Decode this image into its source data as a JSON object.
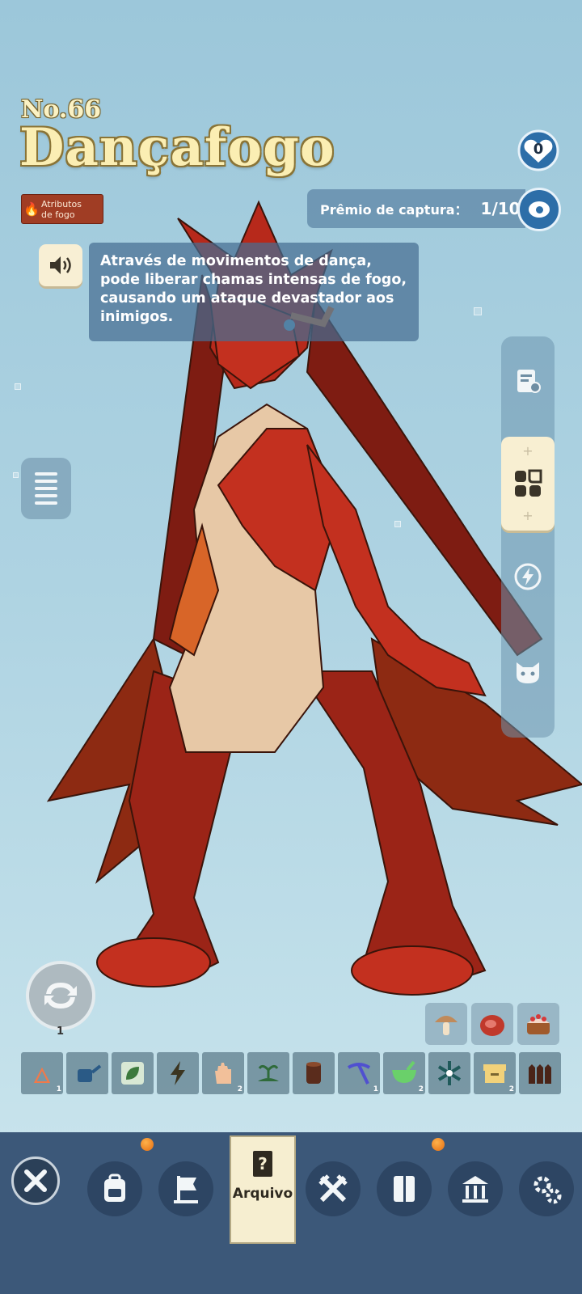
{
  "monster": {
    "number": "No.66",
    "name": "Dançafogo",
    "attribute_line1": "Atributos",
    "attribute_line2": "de fogo",
    "favorite_count": "0",
    "capture_label": "Prêmio de captura：",
    "capture_value": "1/10",
    "description": "Através de movimentos de dança, pode liberar chamas intensas de fogo, causando um ataque devastador aos inimigos."
  },
  "swap": {
    "count": "1",
    "icon": "swap-arrows-icon"
  },
  "food": [
    "mushroom-icon",
    "meat-icon",
    "cake-icon"
  ],
  "skills": [
    {
      "icon": "campfire-icon",
      "count": "1"
    },
    {
      "icon": "watering-can-icon",
      "count": ""
    },
    {
      "icon": "leaf-icon",
      "count": ""
    },
    {
      "icon": "lightning-icon",
      "count": ""
    },
    {
      "icon": "hand-icon",
      "count": "2"
    },
    {
      "icon": "sprout-icon",
      "count": ""
    },
    {
      "icon": "log-icon",
      "count": ""
    },
    {
      "icon": "pickaxe-icon",
      "count": "1"
    },
    {
      "icon": "mortar-icon",
      "count": "2"
    },
    {
      "icon": "snowflake-icon",
      "count": ""
    },
    {
      "icon": "box-icon",
      "count": "2"
    },
    {
      "icon": "fence-icon",
      "count": ""
    }
  ],
  "side_tabs": [
    "stats-icon",
    "grid-icon",
    "lightning-icon",
    "cat-icon"
  ],
  "nav": {
    "active_label": "Arquivo",
    "items": [
      "close-icon",
      "backpack-icon",
      "flag-icon",
      "archive-icon",
      "crossed-swords-icon",
      "book-icon",
      "museum-icon",
      "settings-icon"
    ]
  },
  "colors": {
    "accent_fire": "#a03d24",
    "nav_bg": "#3c5879",
    "title": "#fbeeb3",
    "panel": "#f8efd2",
    "notification": "#e46d12"
  }
}
